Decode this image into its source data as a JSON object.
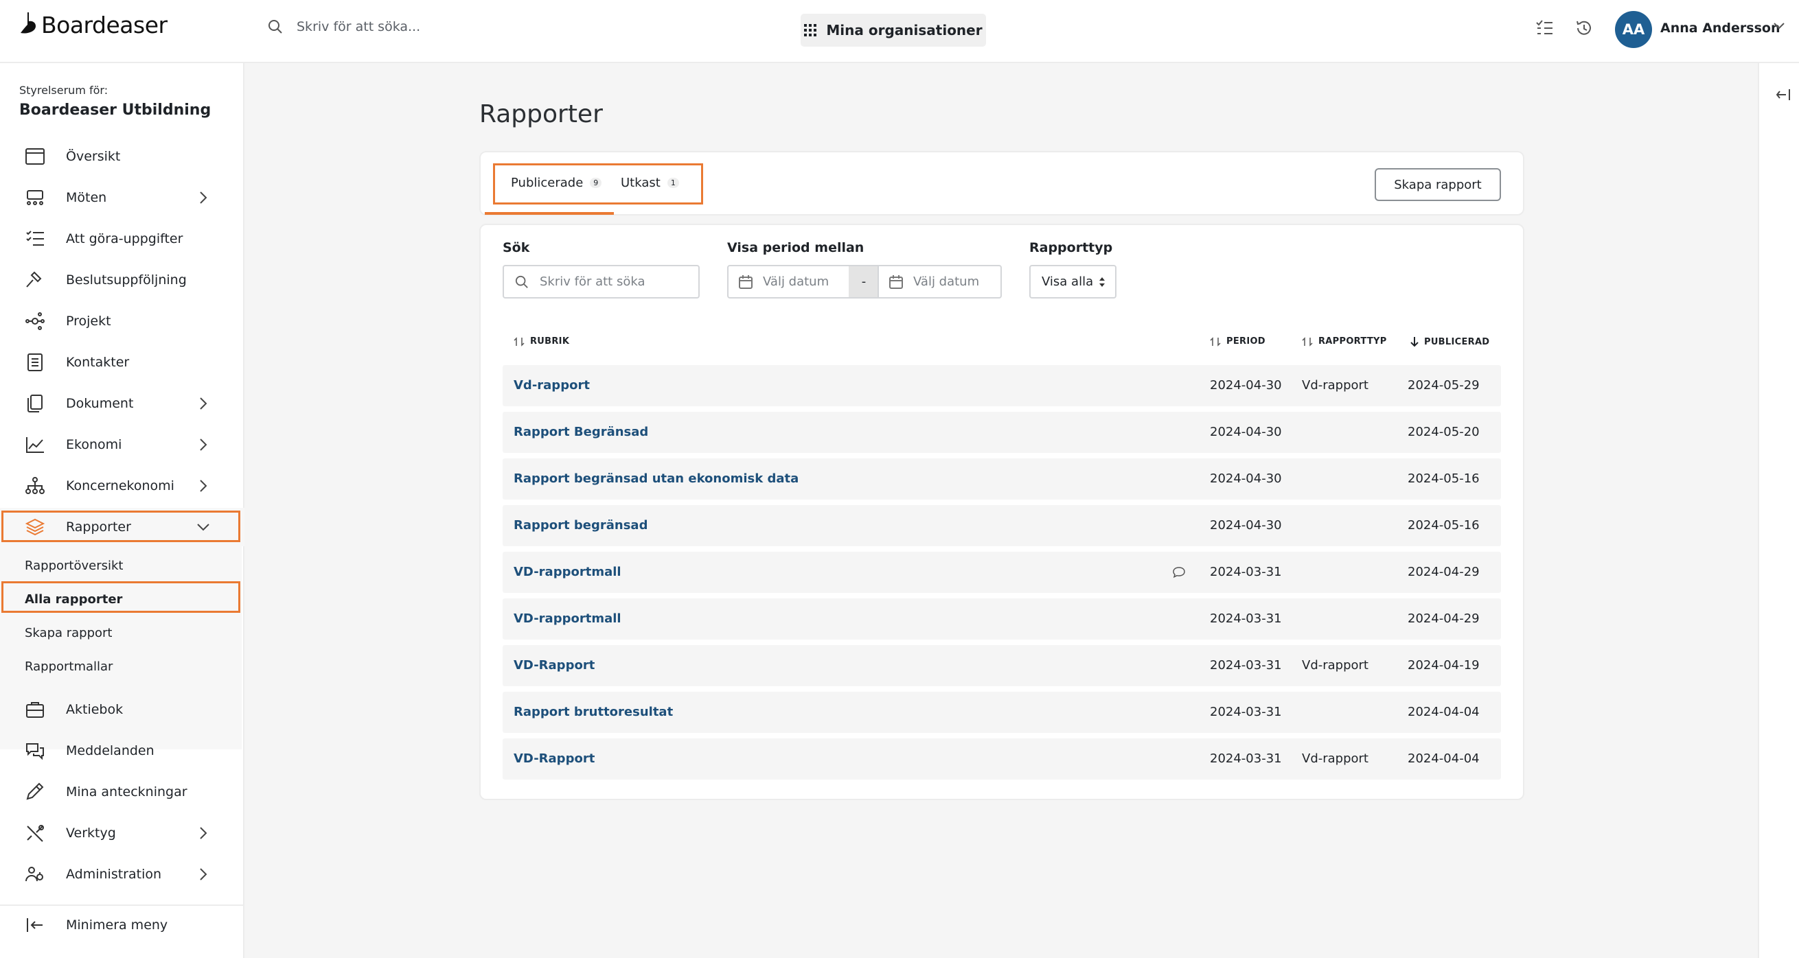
{
  "app": {
    "logo_text": "Boardeaser",
    "search_placeholder": "Skriv för att söka...",
    "org_button": "Mina organisationer",
    "user": {
      "initials": "AA",
      "name": "Anna Andersson"
    }
  },
  "sidebar": {
    "subtitle": "Styrelserum för:",
    "org_name": "Boardeaser Utbildning",
    "items": [
      {
        "label": "Översikt",
        "icon": "calendar-window-icon",
        "chevron": ""
      },
      {
        "label": "Möten",
        "icon": "meeting-icon",
        "chevron": "right"
      },
      {
        "label": "Att göra-uppgifter",
        "icon": "task-list-icon",
        "chevron": ""
      },
      {
        "label": "Beslutsuppföljning",
        "icon": "gavel-icon",
        "chevron": ""
      },
      {
        "label": "Projekt",
        "icon": "network-icon",
        "chevron": ""
      },
      {
        "label": "Kontakter",
        "icon": "contacts-book-icon",
        "chevron": ""
      },
      {
        "label": "Dokument",
        "icon": "documents-icon",
        "chevron": "right"
      },
      {
        "label": "Ekonomi",
        "icon": "line-chart-icon",
        "chevron": "right"
      },
      {
        "label": "Koncernekonomi",
        "icon": "hierarchy-icon",
        "chevron": "right"
      },
      {
        "label": "Rapporter",
        "icon": "layers-icon",
        "chevron": "down"
      }
    ],
    "sub_items": [
      "Rapportöversikt",
      "Alla rapporter",
      "Skapa rapport",
      "Rapportmallar"
    ],
    "items_bottom": [
      {
        "label": "Aktiebok",
        "icon": "briefcase-icon",
        "chevron": ""
      },
      {
        "label": "Meddelanden",
        "icon": "chat-bubbles-icon",
        "chevron": ""
      },
      {
        "label": "Mina anteckningar",
        "icon": "pencil-icon",
        "chevron": ""
      },
      {
        "label": "Verktyg",
        "icon": "tools-icon",
        "chevron": "right"
      },
      {
        "label": "Administration",
        "icon": "users-admin-icon",
        "chevron": "right"
      }
    ],
    "minimize": "Minimera meny"
  },
  "main": {
    "title": "Rapporter",
    "tabs": [
      {
        "label": "Publicerade",
        "count": "9"
      },
      {
        "label": "Utkast",
        "count": "1"
      }
    ],
    "create_button": "Skapa rapport",
    "filters": {
      "search_label": "Sök",
      "search_placeholder": "Skriv för att söka",
      "period_label": "Visa period mellan",
      "date_from_placeholder": "Välj datum",
      "date_separator": "-",
      "date_to_placeholder": "Välj datum",
      "type_label": "Rapporttyp",
      "type_value": "Visa alla"
    },
    "columns": {
      "title": "RUBRIK",
      "period": "PERIOD",
      "type": "RAPPORTTYP",
      "published": "PUBLICERAD"
    },
    "rows": [
      {
        "title": "Vd-rapport",
        "period": "2024-04-30",
        "type": "Vd-rapport",
        "published": "2024-05-29",
        "comment": false
      },
      {
        "title": "Rapport Begränsad",
        "period": "2024-04-30",
        "type": "",
        "published": "2024-05-20",
        "comment": false
      },
      {
        "title": "Rapport begränsad utan ekonomisk data",
        "period": "2024-04-30",
        "type": "",
        "published": "2024-05-16",
        "comment": false
      },
      {
        "title": "Rapport begränsad",
        "period": "2024-04-30",
        "type": "",
        "published": "2024-05-16",
        "comment": false
      },
      {
        "title": "VD-rapportmall",
        "period": "2024-03-31",
        "type": "",
        "published": "2024-04-29",
        "comment": true
      },
      {
        "title": "VD-rapportmall",
        "period": "2024-03-31",
        "type": "",
        "published": "2024-04-29",
        "comment": false
      },
      {
        "title": "VD-Rapport",
        "period": "2024-03-31",
        "type": "Vd-rapport",
        "published": "2024-04-19",
        "comment": false
      },
      {
        "title": "Rapport bruttoresultat",
        "period": "2024-03-31",
        "type": "",
        "published": "2024-04-04",
        "comment": false
      },
      {
        "title": "VD-Rapport",
        "period": "2024-03-31",
        "type": "Vd-rapport",
        "published": "2024-04-04",
        "comment": false
      }
    ]
  },
  "colors": {
    "accent": "#ea7a33",
    "link": "#1d4f7a",
    "avatar": "#1f5f93"
  }
}
